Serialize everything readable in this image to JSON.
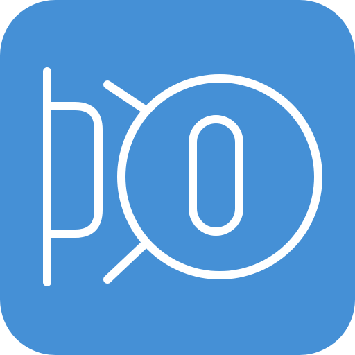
{
  "icon": {
    "name": "app-logo-icon",
    "background_color": "#4590d6",
    "stroke_color": "#ffffff"
  }
}
